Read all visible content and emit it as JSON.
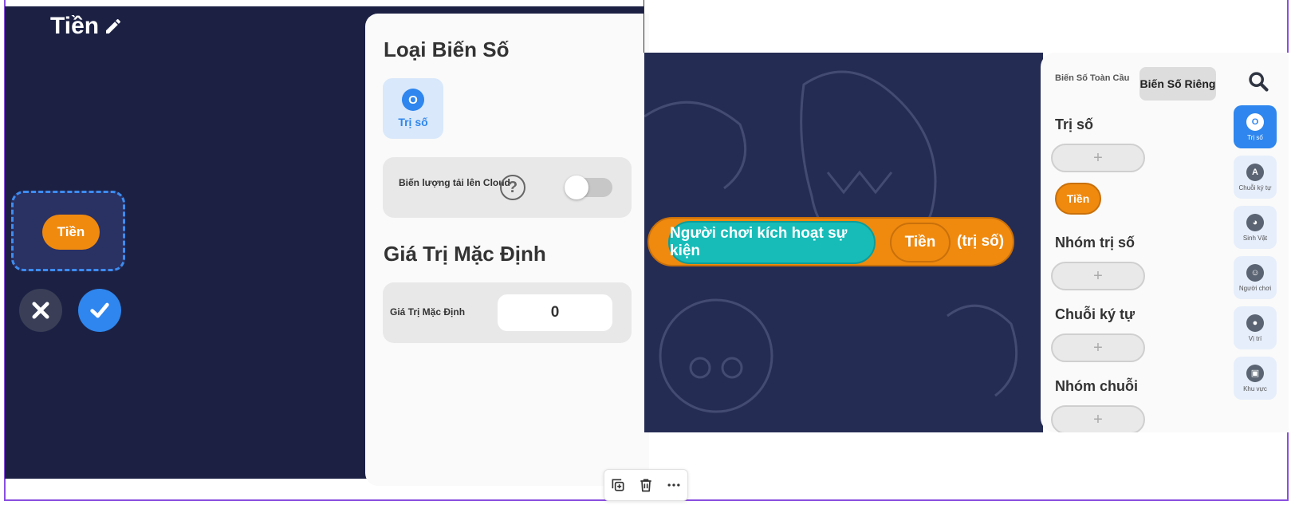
{
  "left": {
    "variable_name": "Tiền",
    "preview_label": "Tiền",
    "settings": {
      "type_section_title": "Loại Biến Số",
      "type_option_icon": "O",
      "type_option_label": "Trị số",
      "cloud_label": "Biến lượng tải lên Cloud",
      "help_symbol": "?",
      "default_section_title": "Giá Trị Mặc Định",
      "default_label": "Giá Trị Mặc Định",
      "default_value": "0"
    }
  },
  "right": {
    "event_block": "Người chơi kích hoạt sự kiện",
    "variable_chip": "Tiền",
    "type_suffix": "(trị số)",
    "tabs": {
      "global": "Biến Số Toàn Cầu",
      "local": "Biến Số Riêng"
    },
    "groups": [
      {
        "title": "Trị số",
        "add_symbol": "+"
      },
      {
        "title": "Nhóm trị số",
        "add_symbol": "+"
      },
      {
        "title": "Chuỗi ký tự",
        "add_symbol": "+"
      },
      {
        "title": "Nhóm chuỗi",
        "add_symbol": "+"
      }
    ],
    "variable_item": "Tiền",
    "categories": [
      {
        "icon": "O",
        "label": "Trị số"
      },
      {
        "icon": "A",
        "label": "Chuỗi ký tự"
      },
      {
        "icon": "◕",
        "label": "Sinh Vật"
      },
      {
        "icon": "☺",
        "label": "Người chơi"
      },
      {
        "icon": "●",
        "label": "Vị trí"
      },
      {
        "icon": "▣",
        "label": "Khu vực"
      }
    ]
  },
  "colors": {
    "accent": "#2e86ee",
    "variable_orange": "#ef8a0f",
    "event_teal": "#17bcb8",
    "canvas_dark": "#1c2144"
  }
}
